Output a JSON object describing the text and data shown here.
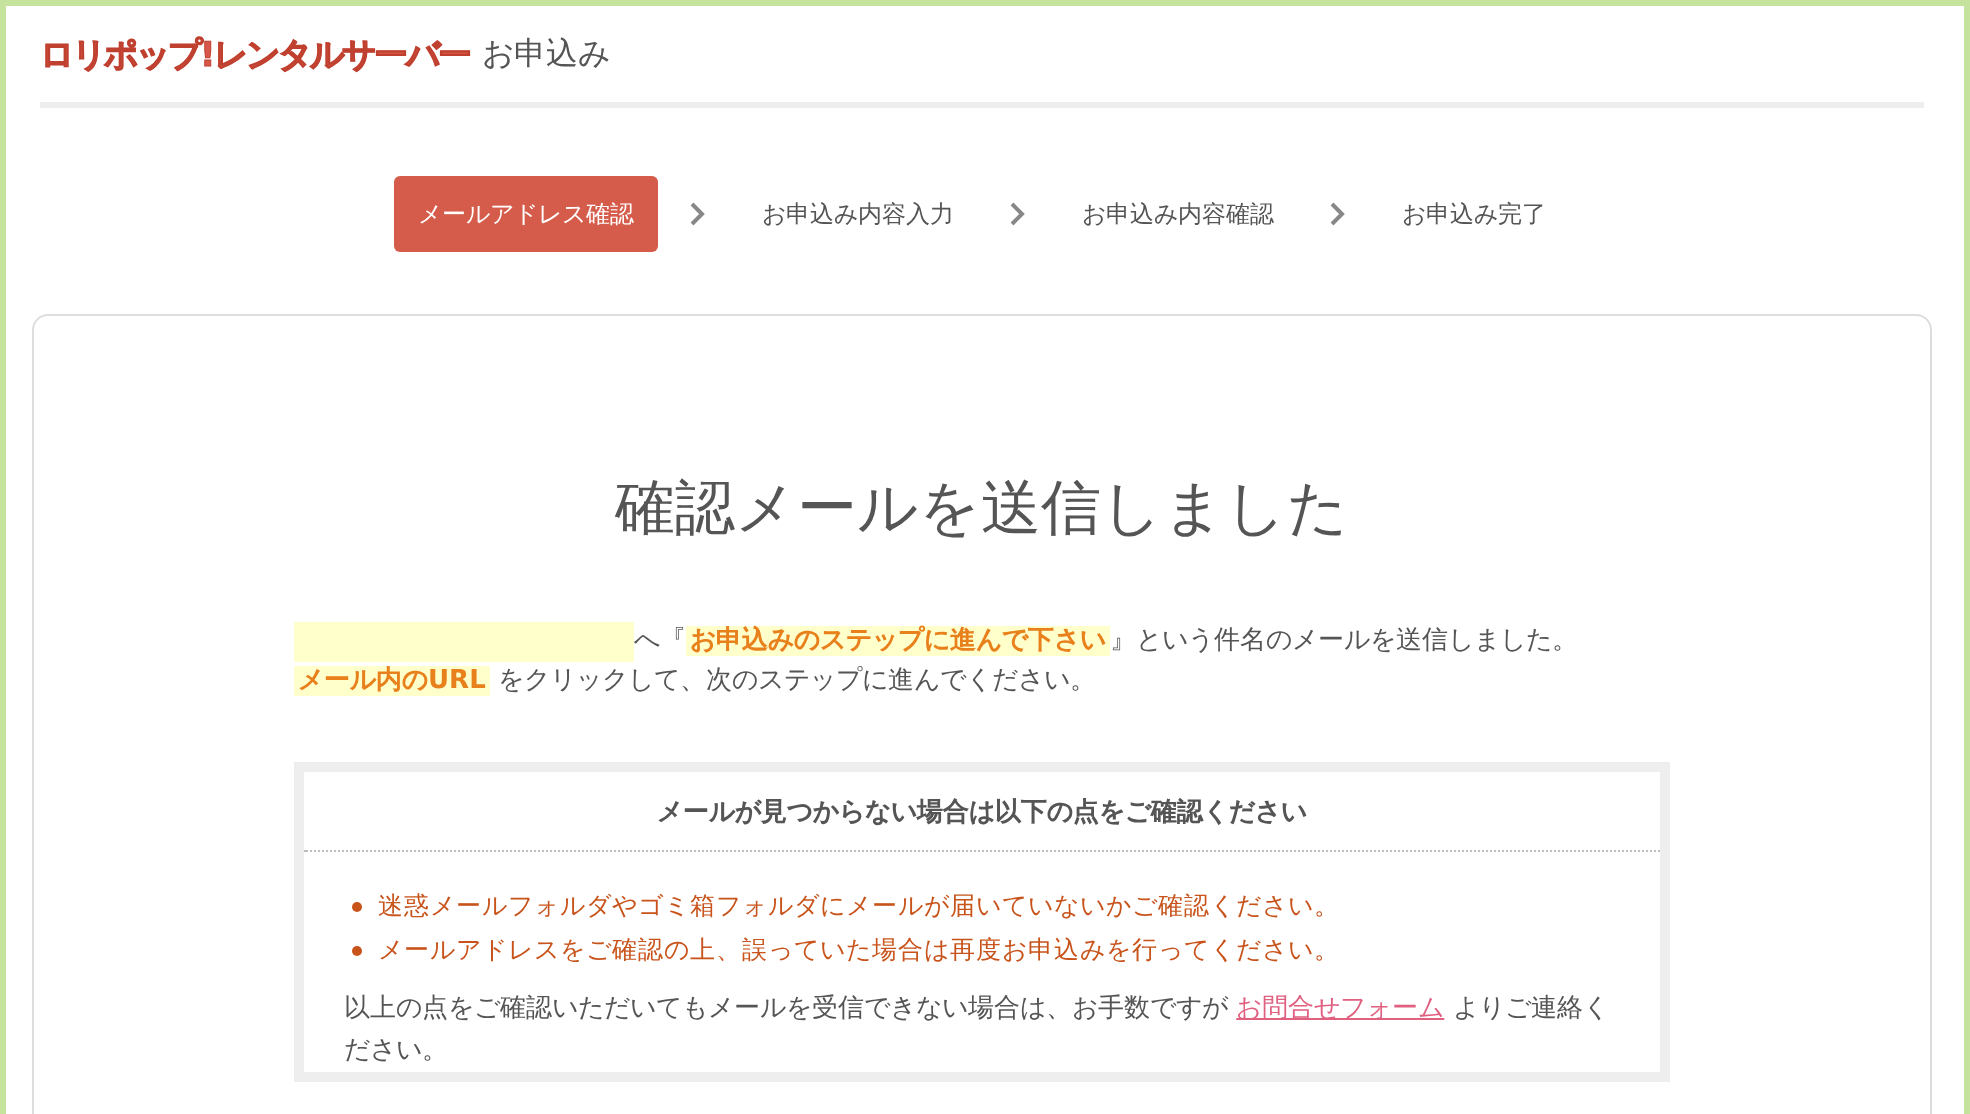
{
  "header": {
    "logo": "ロリポップ!レンタルサーバー",
    "title": "お申込み"
  },
  "steps": [
    {
      "label": "メールアドレス確認",
      "selected": true
    },
    {
      "label": "お申込み内容入力",
      "selected": false
    },
    {
      "label": "お申込み内容確認",
      "selected": false
    },
    {
      "label": "お申込み完了",
      "selected": false
    }
  ],
  "main": {
    "heading": "確認メールを送信しました",
    "message_line_1": "へ『**お申込みのステップに進んで下さい**』という件名のメールを送信しました。",
    "message_line_2": "**メール内のURL** をクリックして、次のステップに進んでください。",
    "notice": {
      "title": "メールが見つからない場合は以下の点をご確認ください",
      "items": [
        "迷惑メールフォルダやゴミ箱フォルダにメールが届いていないかご確認ください。",
        "メールアドレスをご確認の上、誤っていた場合は再度お申込みを行ってください。"
      ],
      "footer_before": "以上の点をご確認いただいてもメールを受信できない場合は、お手数ですが ",
      "footer_link": "お問合せフォーム",
      "footer_after": " よりご連絡ください。"
    }
  }
}
